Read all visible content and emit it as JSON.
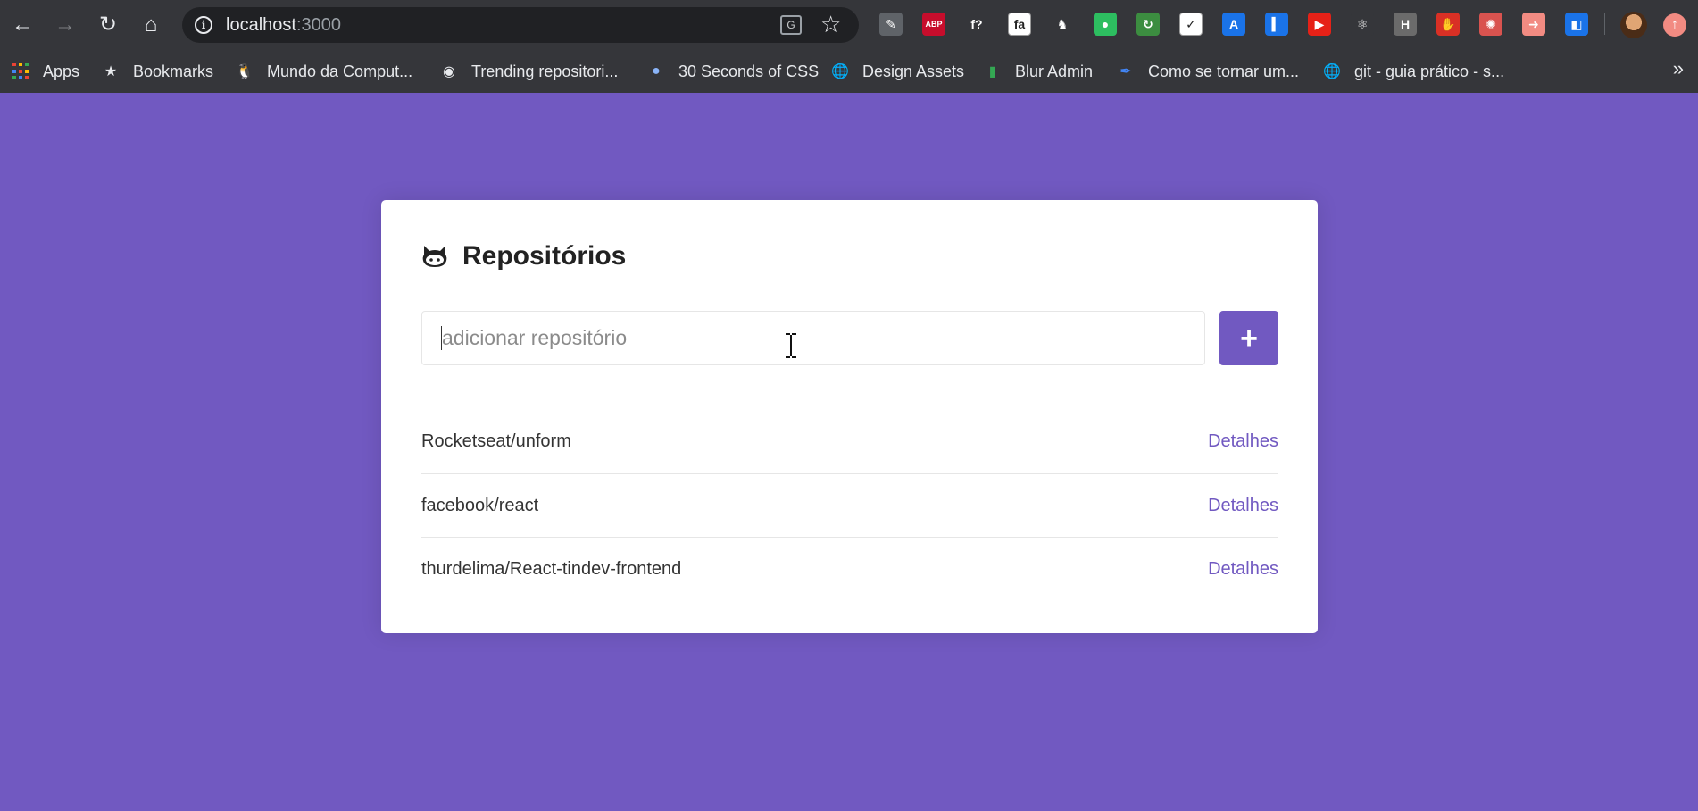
{
  "browser": {
    "url_host": "localhost",
    "url_port": ":3000",
    "nav_icons": [
      "back-arrow-icon",
      "forward-arrow-icon",
      "reload-icon",
      "home-icon"
    ],
    "extensions": [
      {
        "name": "pen-extension-icon",
        "color": "#5f6368",
        "glyph": "✎"
      },
      {
        "name": "adblock-plus-icon",
        "color": "#c70d2c",
        "glyph": "ABP"
      },
      {
        "name": "whatfont-icon",
        "color": "#35363a",
        "glyph": "f?"
      },
      {
        "name": "fontawesome-icon",
        "color": "#ffffff",
        "glyph": "fa"
      },
      {
        "name": "horse-extension-icon",
        "color": "#35363a",
        "glyph": "♞"
      },
      {
        "name": "evernote-icon",
        "color": "#2dbe60",
        "glyph": "●"
      },
      {
        "name": "refresh-extension-icon",
        "color": "#3c8d40",
        "glyph": "↻"
      },
      {
        "name": "checkmark-extension-icon",
        "color": "#ffffff",
        "glyph": "✓"
      },
      {
        "name": "angular-extension-icon",
        "color": "#1a73e8",
        "glyph": "A"
      },
      {
        "name": "bookmark-extension-icon",
        "color": "#1a73e8",
        "glyph": "▍"
      },
      {
        "name": "youtube-extension-icon",
        "color": "#e62117",
        "glyph": "▶"
      },
      {
        "name": "react-devtools-icon",
        "color": "#35363a",
        "glyph": "⚛"
      },
      {
        "name": "header-extension-icon",
        "color": "#6b6b6b",
        "glyph": "H"
      },
      {
        "name": "block-hand-icon",
        "color": "#d93025",
        "glyph": "✋"
      },
      {
        "name": "octopus-extension-icon",
        "color": "#d9534f",
        "glyph": "✺"
      },
      {
        "name": "cast-extension-icon",
        "color": "#f28b82",
        "glyph": "➜"
      },
      {
        "name": "window-extension-icon",
        "color": "#1a73e8",
        "glyph": "◧"
      }
    ]
  },
  "bookmarks": [
    {
      "label": "Apps",
      "icon": "apps-grid-icon"
    },
    {
      "label": "Bookmarks",
      "icon": "star-icon"
    },
    {
      "label": "Mundo da Comput...",
      "icon": "linux-penguin-icon"
    },
    {
      "label": "Trending repositori...",
      "icon": "github-icon"
    },
    {
      "label": "30 Seconds of CSS",
      "icon": "globe-blue-icon"
    },
    {
      "label": "Design Assets",
      "icon": "globe-icon"
    },
    {
      "label": "Blur Admin",
      "icon": "bar-chart-icon"
    },
    {
      "label": "Como se tornar um...",
      "icon": "feather-icon"
    },
    {
      "label": "git - guia prático - s...",
      "icon": "globe-icon"
    }
  ],
  "page": {
    "title": "Repositórios",
    "title_icon": "github-icon",
    "input_placeholder": "adicionar repositório",
    "add_button_label": "+",
    "accent_color": "#7159c1",
    "repositories": [
      {
        "name": "Rocketseat/unform",
        "link": "Detalhes"
      },
      {
        "name": "facebook/react",
        "link": "Detalhes"
      },
      {
        "name": "thurdelima/React-tindev-frontend",
        "link": "Detalhes"
      }
    ]
  }
}
